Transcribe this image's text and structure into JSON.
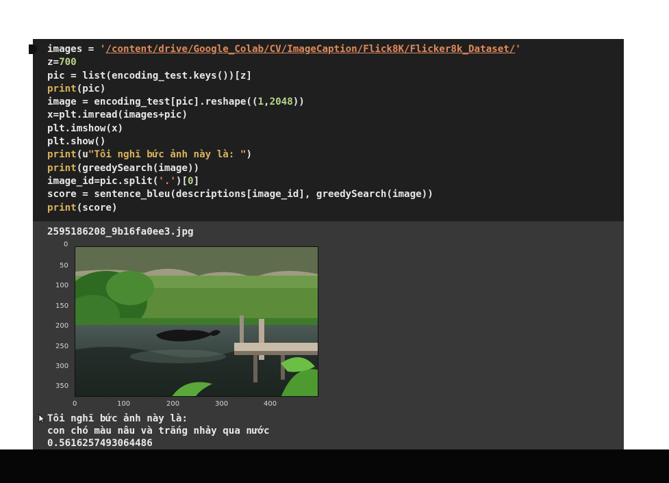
{
  "code_cell": {
    "lines": [
      {
        "parts": [
          {
            "t": "images = ",
            "c": ""
          },
          {
            "t": "'",
            "c": "str"
          },
          {
            "t": "/content/drive/Google_Colab/CV/ImageCaption/Flick8K/Flicker8k_Dataset/",
            "c": "path"
          },
          {
            "t": "'",
            "c": "str"
          }
        ]
      },
      {
        "parts": [
          {
            "t": "z=",
            "c": ""
          },
          {
            "t": "700",
            "c": "num"
          }
        ]
      },
      {
        "parts": [
          {
            "t": "pic = list(encoding_test.keys())[z]",
            "c": ""
          }
        ]
      },
      {
        "parts": [
          {
            "t": "print",
            "c": "kw"
          },
          {
            "t": "(pic)",
            "c": ""
          }
        ]
      },
      {
        "parts": [
          {
            "t": "image = encoding_test[pic].reshape((",
            "c": ""
          },
          {
            "t": "1",
            "c": "num"
          },
          {
            "t": ",",
            "c": ""
          },
          {
            "t": "2048",
            "c": "num"
          },
          {
            "t": "))",
            "c": ""
          }
        ]
      },
      {
        "parts": [
          {
            "t": "x=plt.imread(images+pic)",
            "c": ""
          }
        ]
      },
      {
        "parts": [
          {
            "t": "plt.imshow(x)",
            "c": ""
          }
        ]
      },
      {
        "parts": [
          {
            "t": "plt.show()",
            "c": ""
          }
        ]
      },
      {
        "parts": [
          {
            "t": "print",
            "c": "kw"
          },
          {
            "t": "(u",
            "c": ""
          },
          {
            "t": "\"Tôi nghĩ bức ảnh này là: \"",
            "c": "kw"
          },
          {
            "t": ")",
            "c": ""
          }
        ]
      },
      {
        "parts": [
          {
            "t": "print",
            "c": "kw"
          },
          {
            "t": "(greedySearch(image))",
            "c": ""
          }
        ]
      },
      {
        "parts": [
          {
            "t": "image_id=pic.split(",
            "c": ""
          },
          {
            "t": "'.'",
            "c": "str"
          },
          {
            "t": ")[",
            "c": ""
          },
          {
            "t": "0",
            "c": "num"
          },
          {
            "t": "]",
            "c": ""
          }
        ]
      },
      {
        "parts": [
          {
            "t": "score = sentence_bleu(descriptions[image_id], greedySearch(image))",
            "c": ""
          }
        ]
      },
      {
        "parts": [
          {
            "t": "print",
            "c": "kw"
          },
          {
            "t": "(score)",
            "c": ""
          }
        ]
      }
    ]
  },
  "output": {
    "filename": "2595186208_9b16fa0ee3.jpg",
    "plot": {
      "y_ticks": [
        "0",
        "50",
        "100",
        "150",
        "200",
        "250",
        "300",
        "350"
      ],
      "x_ticks": [
        "0",
        "100",
        "200",
        "300",
        "400"
      ],
      "image_description_icon": "photo-dog-jumping-pond"
    },
    "caption_intro": "Tôi nghĩ bức ảnh này là:",
    "caption": "con chó màu nâu và trắng nhảy qua nước",
    "score": "0.5616257493064486"
  },
  "colors": {
    "code_bg": "#1f1f1f",
    "output_bg": "#383838",
    "keyword": "#d8b35a",
    "string": "#e08a5d",
    "number": "#b7d686"
  }
}
